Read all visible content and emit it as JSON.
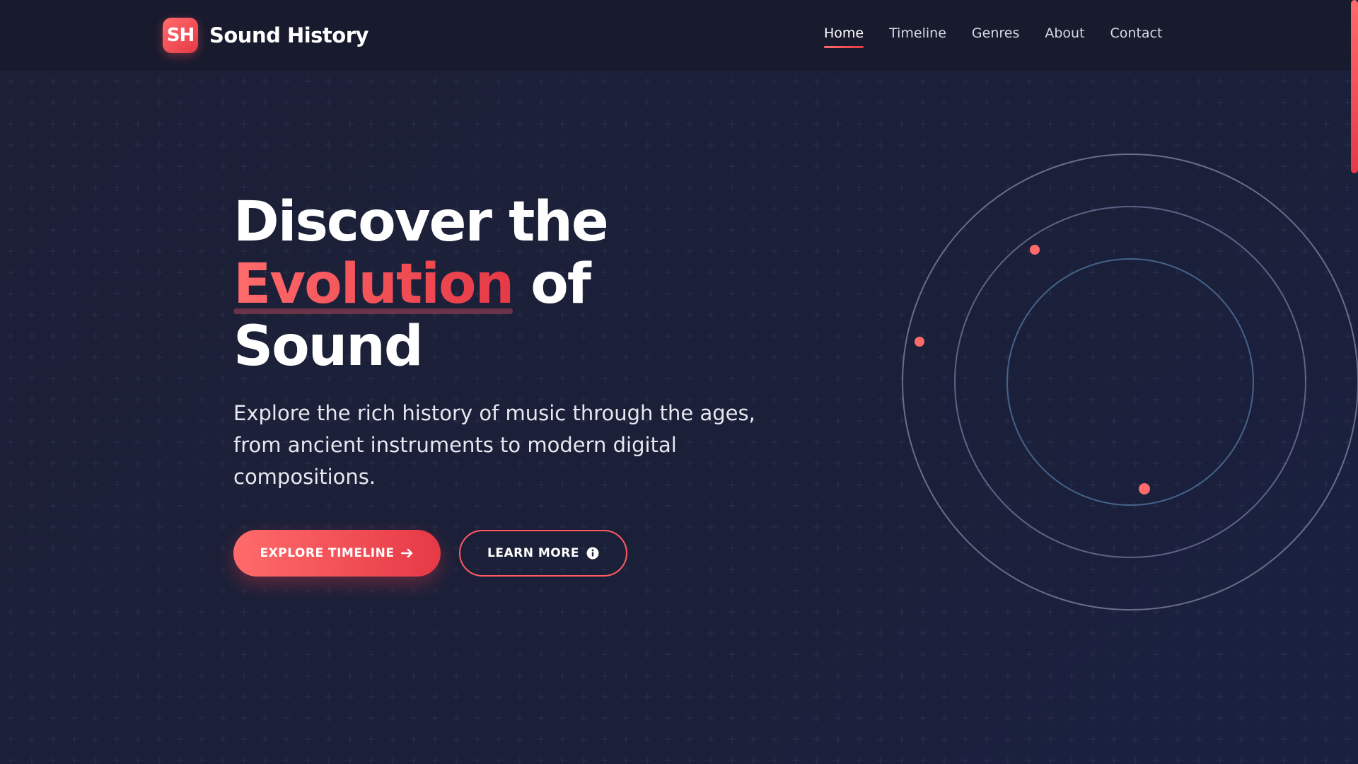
{
  "brand": {
    "badge": "SH",
    "name": "Sound History"
  },
  "nav": {
    "items": [
      {
        "label": "Home",
        "active": true
      },
      {
        "label": "Timeline",
        "active": false
      },
      {
        "label": "Genres",
        "active": false
      },
      {
        "label": "About",
        "active": false
      },
      {
        "label": "Contact",
        "active": false
      }
    ]
  },
  "hero": {
    "title_line1": "Discover the",
    "title_accent": "Evolution",
    "title_of": " of",
    "title_line3": "Sound",
    "description": "Explore the rich history of music through the ages, from ancient instruments to modern digital compositions.",
    "primary_button": "EXPLORE TIMELINE",
    "primary_icon": "arrow-right-icon",
    "secondary_button": "LEARN MORE",
    "secondary_icon": "info-icon"
  },
  "colors": {
    "accent_start": "#ff6b6b",
    "accent_end": "#e63946",
    "background": "#1b1f36",
    "header": "#181a2e"
  }
}
